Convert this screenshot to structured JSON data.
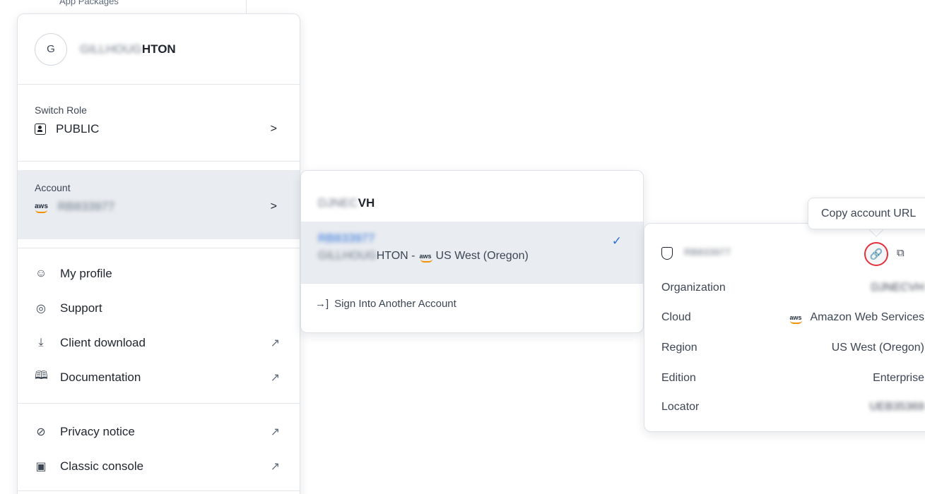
{
  "background_nav": {
    "partial_item": "App Packages"
  },
  "user_menu": {
    "avatar_initial": "G",
    "username_hidden": "GILLHOUG",
    "username_visible": "HTON",
    "switch_role": {
      "label": "Switch Role",
      "value": "PUBLIC",
      "chevron": ">"
    },
    "account": {
      "label": "Account",
      "value_hidden": "RB833977",
      "chevron": ">"
    },
    "items": [
      {
        "label": "My profile",
        "icon": "profile-icon",
        "glyph": "☺",
        "external": false
      },
      {
        "label": "Support",
        "icon": "support-icon",
        "glyph": "◎",
        "external": false
      },
      {
        "label": "Client download",
        "icon": "download-icon",
        "glyph": "⤓",
        "external": true
      },
      {
        "label": "Documentation",
        "icon": "book-icon",
        "glyph": "🕮",
        "external": true
      }
    ],
    "items2": [
      {
        "label": "Privacy notice",
        "icon": "privacy-icon",
        "glyph": "⊘",
        "external": true
      },
      {
        "label": "Classic console",
        "icon": "console-icon",
        "glyph": "▣",
        "external": true
      }
    ],
    "external_glyph": "↗"
  },
  "account_submenu": {
    "org_hidden": "DJNEC",
    "org_visible": "VH",
    "account_id_hidden": "RB833977",
    "account_user_hidden": "GILLHOUG",
    "account_user_visible": "HTON - ",
    "region": "US West (Oregon)",
    "check": "✓",
    "signin_icon": "→]",
    "signin_label": "Sign Into Another Account"
  },
  "account_details": {
    "account_hidden": "RB833977",
    "rows": [
      {
        "key": "Organization",
        "value": "DJNECVH",
        "hidden": true
      },
      {
        "key": "Cloud",
        "value": "Amazon Web Services",
        "hidden": false,
        "logo": true
      },
      {
        "key": "Region",
        "value": "US West (Oregon)",
        "hidden": false
      },
      {
        "key": "Edition",
        "value": "Enterprise",
        "hidden": false
      },
      {
        "key": "Locator",
        "value": "UEB35369",
        "hidden": true
      }
    ],
    "link_glyph": "🔗",
    "copy_glyph": "⧉"
  },
  "tooltip": {
    "text": "Copy account URL"
  },
  "aws_logo_text": "aws",
  "colors": {
    "accent": "#2a6fdc",
    "highlight_ring": "#e2313c",
    "aws_orange": "#f29100",
    "selected_bg": "#e9ecf0"
  }
}
